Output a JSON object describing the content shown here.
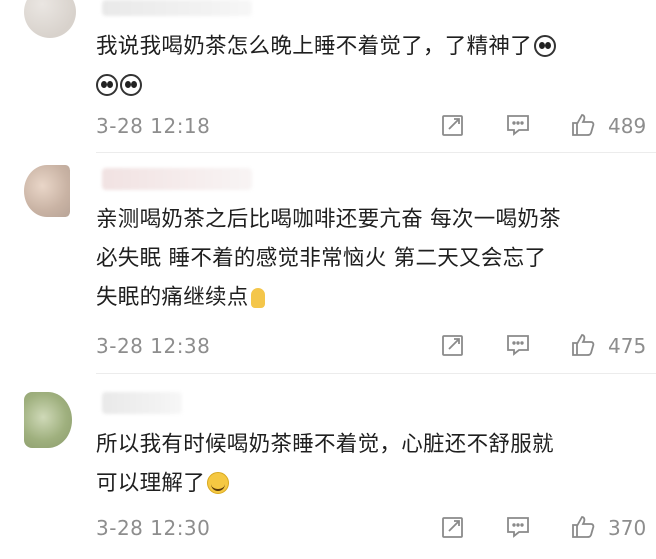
{
  "comments": [
    {
      "text_lines": [
        "我说我喝奶茶怎么晚上睡不着觉了，了精神了"
      ],
      "emoji_inline": "panda-emoji",
      "emoji_line2": [
        "panda-emoji",
        "panda-emoji"
      ],
      "time": "3-28 12:18",
      "likes": "489"
    },
    {
      "text_lines": [
        "亲测喝奶茶之后比喝咖啡还要亢奋 每次一喝奶茶",
        "必失眠 睡不着的感觉非常恼火 第二天又会忘了",
        "失眠的痛继续点"
      ],
      "emoji_inline": "candle-emoji",
      "time": "3-28 12:38",
      "likes": "475"
    },
    {
      "text_lines": [
        "所以我有时候喝奶茶睡不着觉，心脏还不舒服就",
        "可以理解了"
      ],
      "emoji_inline": "crying-laugh-emoji",
      "time": "3-28 12:30",
      "likes": "370"
    }
  ],
  "partial_header_text": "0921"
}
